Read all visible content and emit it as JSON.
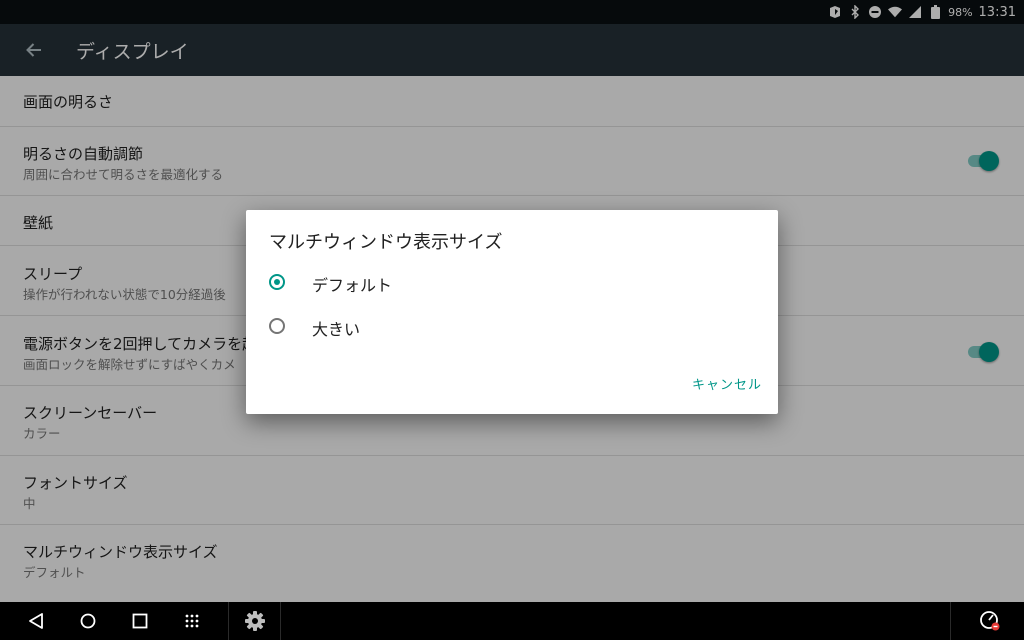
{
  "status_bar": {
    "battery_percent": "98%",
    "time": "13:31",
    "icons": [
      "nfc-icon",
      "bluetooth-icon",
      "do-not-disturb-icon",
      "wifi-icon",
      "signal-icon",
      "battery-icon"
    ]
  },
  "app_bar": {
    "title": "ディスプレイ",
    "back_icon": "arrow-back-icon"
  },
  "settings": {
    "items": [
      {
        "title": "画面の明るさ",
        "subtitle": ""
      },
      {
        "title": "明るさの自動調節",
        "subtitle": "周囲に合わせて明るさを最適化する",
        "toggle": true
      },
      {
        "title": "壁紙",
        "subtitle": ""
      },
      {
        "title": "スリープ",
        "subtitle": "操作が行われない状態で10分経過後"
      },
      {
        "title": "電源ボタンを2回押してカメラを起",
        "subtitle": "画面ロックを解除せずにすばやくカメ",
        "toggle": true
      },
      {
        "title": "スクリーンセーバー",
        "subtitle": "カラー"
      },
      {
        "title": "フォントサイズ",
        "subtitle": "中"
      },
      {
        "title": "マルチウィンドウ表示サイズ",
        "subtitle": "デフォルト"
      }
    ]
  },
  "dialog": {
    "title": "マルチウィンドウ表示サイズ",
    "options": [
      {
        "label": "デフォルト",
        "selected": true
      },
      {
        "label": "大きい",
        "selected": false
      }
    ],
    "cancel_label": "キャンセル"
  },
  "nav_bar": {
    "icons": [
      "nav-back-icon",
      "nav-home-icon",
      "nav-recents-icon",
      "app-drawer-icon",
      "settings-gear-icon",
      "speed-meter-icon"
    ]
  },
  "colors": {
    "accent": "#009688",
    "toggle_track": "#80cbc4",
    "app_bar": "#263238",
    "status_bar": "#0a1012",
    "nav_bar": "#000000"
  }
}
